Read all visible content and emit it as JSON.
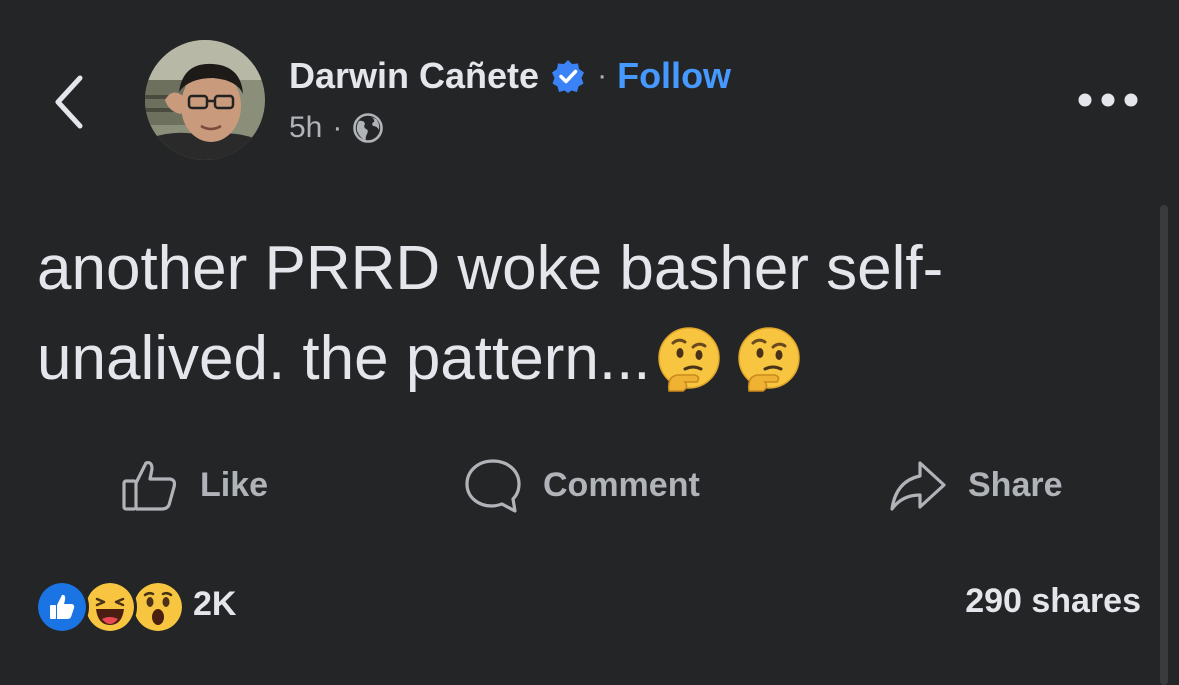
{
  "header": {
    "back_icon": "chevron-left-icon",
    "author_name": "Darwin Cañete",
    "verified_icon": "verified-badge-icon",
    "separator": "·",
    "follow_label": "Follow",
    "time": "5h",
    "meta_separator": "·",
    "audience_icon": "globe-icon",
    "more_icon": "more-horizontal-icon"
  },
  "post": {
    "text": "another PRRD woke basher self-unalived. the pattern...",
    "emojis": [
      "thinking-face",
      "thinking-face"
    ]
  },
  "actions": [
    {
      "label": "Like",
      "icon": "thumbs-up-icon"
    },
    {
      "label": "Comment",
      "icon": "comment-bubble-icon"
    },
    {
      "label": "Share",
      "icon": "share-arrow-icon"
    }
  ],
  "stats": {
    "reactions": [
      "like",
      "haha",
      "wow"
    ],
    "reaction_count": "2K",
    "shares": "290 shares"
  },
  "colors": {
    "background": "#242526",
    "text_primary": "#e4e6eb",
    "text_secondary": "#b0b3b8",
    "link_blue": "#4599ff",
    "verified_blue": "#3b82f6"
  }
}
